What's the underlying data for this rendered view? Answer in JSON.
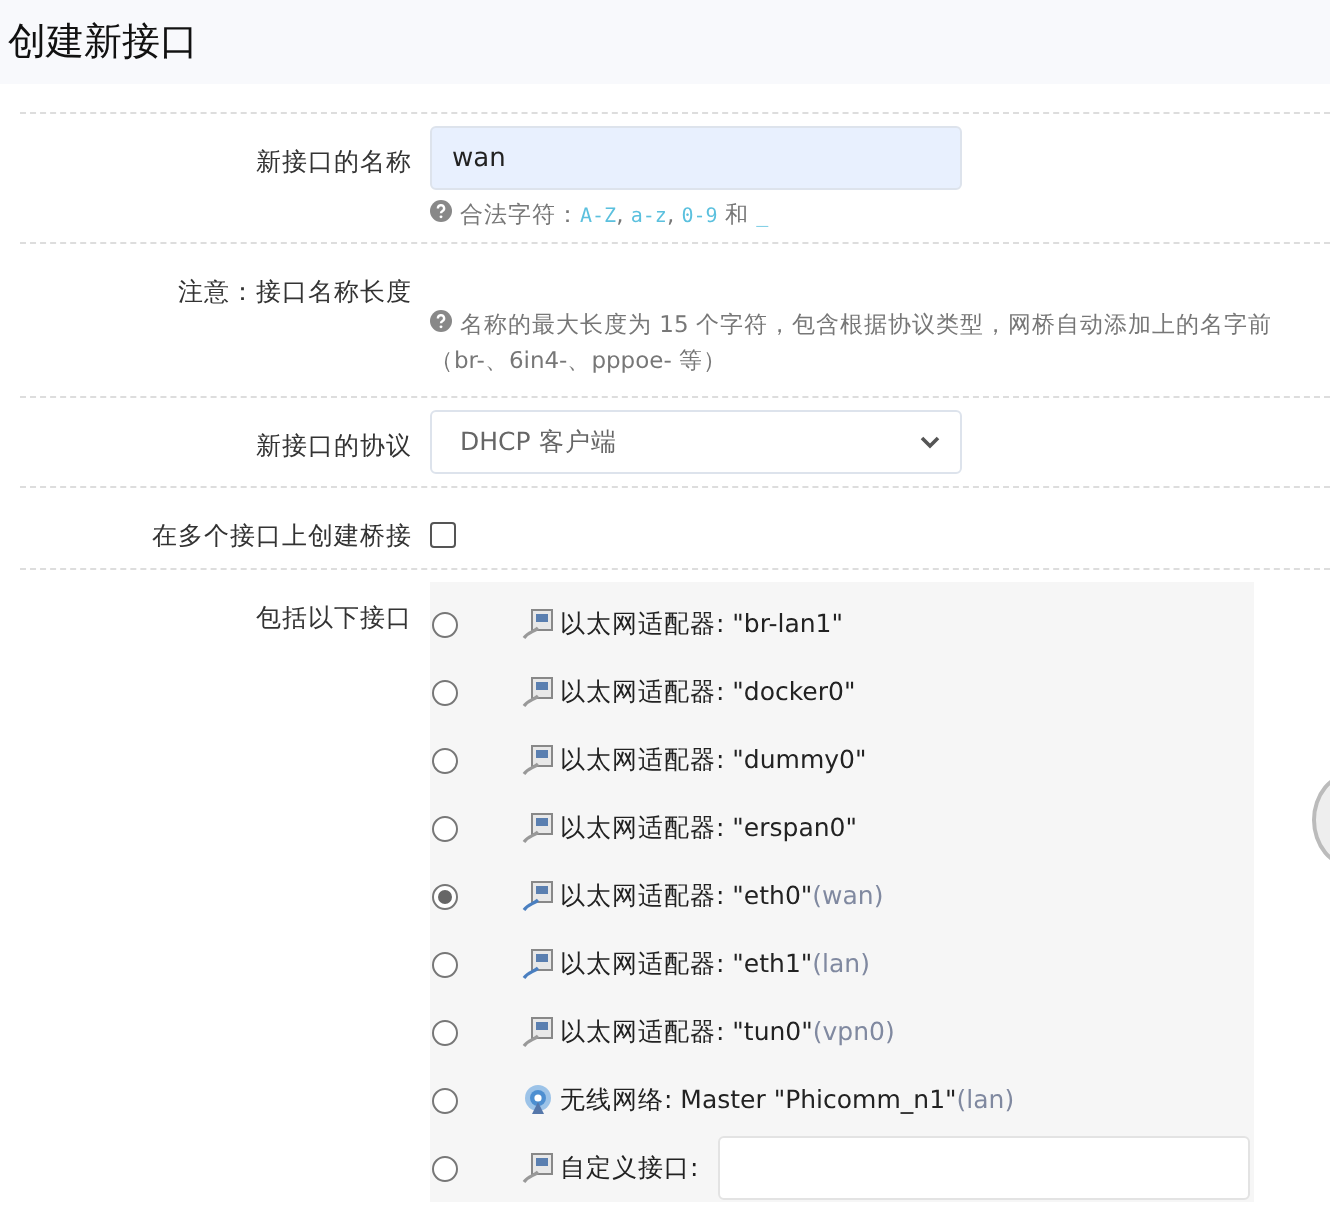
{
  "title": "创建新接口",
  "name_field": {
    "label": "新接口的名称",
    "value": "wan",
    "hint": [
      {
        "kind": "text",
        "text": "合法字符："
      },
      {
        "kind": "code",
        "text": "A-Z"
      },
      {
        "kind": "text",
        "text": ", "
      },
      {
        "kind": "code",
        "text": "a-z"
      },
      {
        "kind": "text",
        "text": ", "
      },
      {
        "kind": "code",
        "text": "0-9"
      },
      {
        "kind": "text",
        "text": " 和 "
      },
      {
        "kind": "code",
        "text": "_"
      }
    ]
  },
  "note": {
    "label": "注意：接口名称长度",
    "hint": "名称的最大长度为 15 个字符，包含根据协议类型，网桥自动添加上的名字前",
    "hint_line2": "（br-、6in4-、pppoe- 等）"
  },
  "protocol": {
    "label": "新接口的协议",
    "value": "DHCP 客户端"
  },
  "bridge": {
    "label": "在多个接口上创建桥接",
    "checked": false
  },
  "interfaces": {
    "label": "包括以下接口",
    "items": [
      {
        "kind": "ethernet",
        "text": "以太网适配器: \"br-lan1\"",
        "active": false,
        "selected": false
      },
      {
        "kind": "ethernet",
        "text": "以太网适配器: \"docker0\"",
        "active": false,
        "selected": false
      },
      {
        "kind": "ethernet",
        "text": "以太网适配器: \"dummy0\"",
        "active": false,
        "selected": false
      },
      {
        "kind": "ethernet",
        "text": "以太网适配器: \"erspan0\"",
        "active": false,
        "selected": false
      },
      {
        "kind": "ethernet",
        "text": "以太网适配器: \"eth0\"",
        "network": "(wan)",
        "active": true,
        "selected": true
      },
      {
        "kind": "ethernet",
        "text": "以太网适配器: \"eth1\"",
        "network": "(lan)",
        "active": true,
        "selected": false
      },
      {
        "kind": "ethernet",
        "text": "以太网适配器: \"tun0\"",
        "network": "(vpn0)",
        "active": false,
        "selected": false
      },
      {
        "kind": "wireless",
        "text": "无线网络: Master \"Phicomm_n1\"",
        "network": "(lan)",
        "selected": false
      },
      {
        "kind": "custom",
        "text": "自定义接口:",
        "active": false,
        "selected": false
      }
    ]
  }
}
